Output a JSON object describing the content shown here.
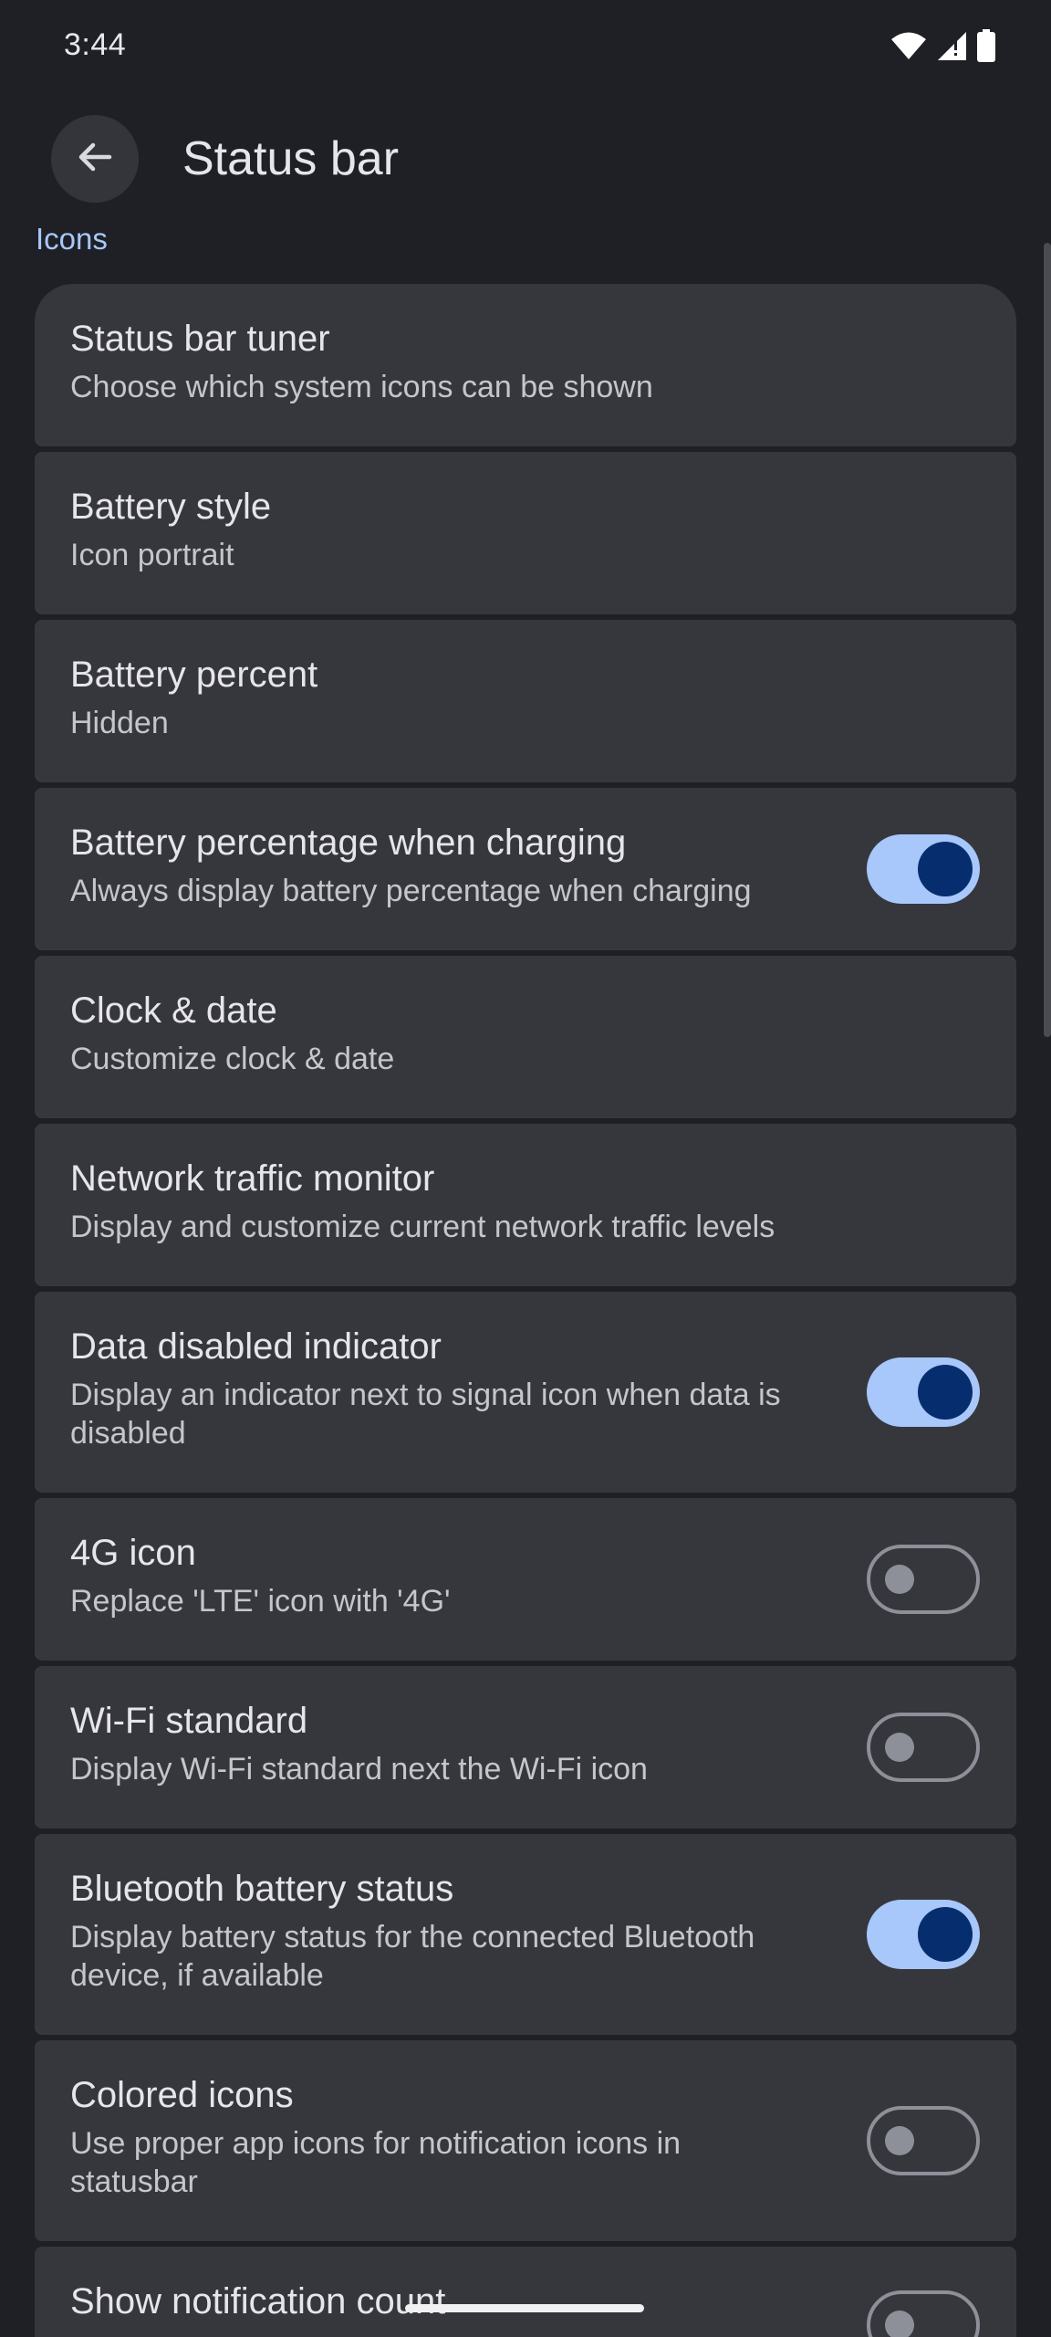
{
  "status_bar": {
    "time": "3:44",
    "icons": [
      "wifi-icon",
      "signal-icon",
      "battery-icon"
    ]
  },
  "header": {
    "title": "Status bar",
    "back_icon": "arrow-left-icon"
  },
  "section": {
    "label": "Icons"
  },
  "items": [
    {
      "title": "Status bar tuner",
      "subtitle": "Choose which system icons can be shown"
    },
    {
      "title": "Battery style",
      "subtitle": "Icon portrait"
    },
    {
      "title": "Battery percent",
      "subtitle": "Hidden"
    },
    {
      "title": "Battery percentage when charging",
      "subtitle": "Always display battery percentage when charging",
      "toggle": true
    },
    {
      "title": "Clock & date",
      "subtitle": "Customize clock & date"
    },
    {
      "title": "Network traffic monitor",
      "subtitle": "Display and customize current network traffic levels"
    },
    {
      "title": "Data disabled indicator",
      "subtitle": "Display an indicator next to signal icon when data is disabled",
      "toggle": true
    },
    {
      "title": "4G icon",
      "subtitle": "Replace 'LTE' icon with '4G'",
      "toggle": false
    },
    {
      "title": "Wi-Fi standard",
      "subtitle": "Display Wi-Fi standard next the Wi-Fi icon",
      "toggle": false
    },
    {
      "title": "Bluetooth battery status",
      "subtitle": "Display battery status for the connected Bluetooth device, if available",
      "toggle": true
    },
    {
      "title": "Colored icons",
      "subtitle": "Use proper app icons for notification icons in statusbar",
      "toggle": false
    },
    {
      "title": "Show notification count",
      "toggle": false
    }
  ],
  "colors": {
    "background": "#1e2025",
    "card": "#36373d",
    "accent": "#a8c7fa",
    "toggle_knob_on": "#062e6f",
    "toggle_off": "#8e9099"
  }
}
